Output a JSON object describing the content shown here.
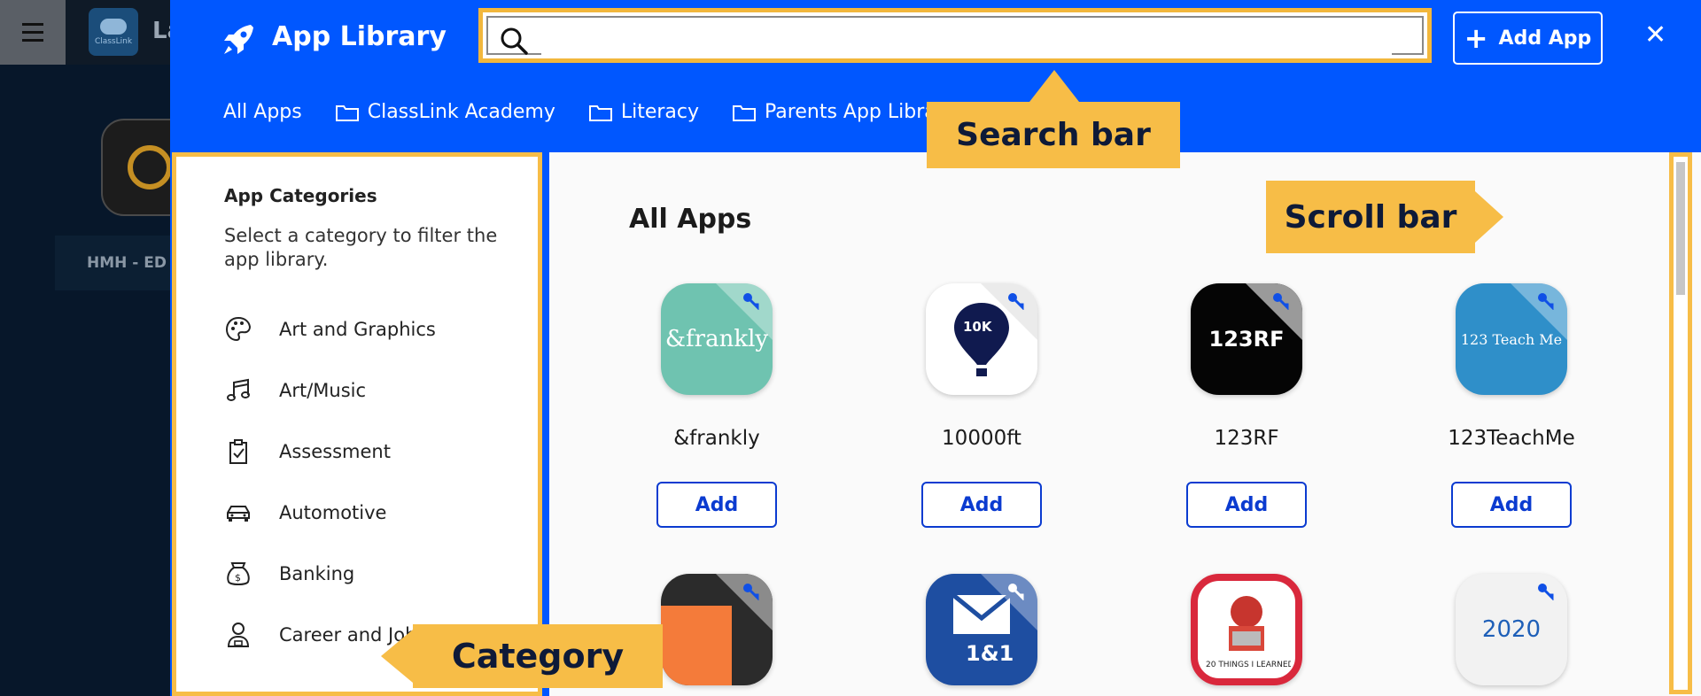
{
  "background": {
    "brand_short": "ClassLink",
    "partial_title": "La",
    "app_label": "HMH - ED"
  },
  "header": {
    "title": "App Library",
    "search": {
      "placeholder": "",
      "value": ""
    },
    "add_app_label": "Add App",
    "close_label": "✕"
  },
  "tabs": [
    {
      "label": "All Apps",
      "active": true,
      "icon": ""
    },
    {
      "label": "ClassLink Academy",
      "active": false,
      "icon": "folder-icon"
    },
    {
      "label": "Literacy",
      "active": false,
      "icon": "folder-icon"
    },
    {
      "label": "Parents App Library",
      "active": false,
      "icon": "folder-icon"
    }
  ],
  "sidebar": {
    "title": "App Categories",
    "description": "Select a category to filter the app library.",
    "categories": [
      {
        "label": "Art and Graphics",
        "icon": "palette-icon"
      },
      {
        "label": "Art/Music",
        "icon": "music-note-icon"
      },
      {
        "label": "Assessment",
        "icon": "clipboard-check-icon"
      },
      {
        "label": "Automotive",
        "icon": "car-icon"
      },
      {
        "label": "Banking",
        "icon": "money-bag-icon"
      },
      {
        "label": "Career and Jobs",
        "icon": "person-briefcase-icon"
      }
    ]
  },
  "content": {
    "title": "All Apps",
    "apps": [
      {
        "name": "&frankly",
        "icon_text": "&frankly",
        "color": "#6fc3b0",
        "add_label": "Add"
      },
      {
        "name": "10000ft",
        "icon_text": "10K",
        "color": "#ffffff",
        "add_label": "Add"
      },
      {
        "name": "123RF",
        "icon_text": "123RF",
        "color": "#050505",
        "add_label": "Add"
      },
      {
        "name": "123TeachMe",
        "icon_text": "123 Teach Me",
        "color": "#2f8fc9",
        "add_label": "Add"
      },
      {
        "name": "",
        "icon_text": "",
        "color": "#2b2b2b",
        "add_label": ""
      },
      {
        "name": "",
        "icon_text": "1&1",
        "color": "#1e4ea1",
        "add_label": ""
      },
      {
        "name": "",
        "icon_text": "20 THINGS I LEARNED",
        "color": "#ffffff",
        "add_label": ""
      },
      {
        "name": "",
        "icon_text": "2020",
        "color": "#f2f2f2",
        "add_label": ""
      }
    ]
  },
  "callouts": {
    "search": "Search bar",
    "scroll": "Scroll bar",
    "category": "Category"
  },
  "colors": {
    "primary": "#0057ff",
    "highlight": "#f7bd47",
    "button_text": "#0b3bd0"
  }
}
